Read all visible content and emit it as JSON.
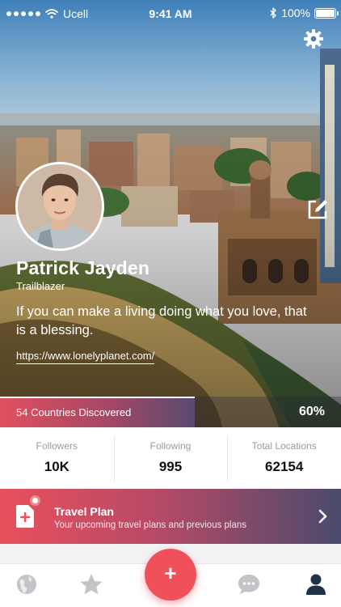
{
  "status_bar": {
    "carrier": "Ucell",
    "time": "9:41 AM",
    "battery": "100%"
  },
  "profile": {
    "name": "Patrick Jayden",
    "title": "Trailblazer",
    "quote": "If you can make a living doing what you love, that is a blessing.",
    "link": "https://www.lonelyplanet.com/"
  },
  "progress": {
    "label": "54 Countries Discovered",
    "percent_label": "60%",
    "fraction": 0.57
  },
  "stats": [
    {
      "label": "Followers",
      "value": "10K"
    },
    {
      "label": "Following",
      "value": "995"
    },
    {
      "label": "Total Locations",
      "value": "62154"
    }
  ],
  "travel_plan": {
    "title": "Travel Plan",
    "subtitle": "Your upcoming travel plans and previous plans"
  },
  "tabbar": {
    "items": [
      "globe-icon",
      "star-icon",
      "add-icon",
      "chat-icon",
      "profile-icon"
    ],
    "active": "profile-icon",
    "fab_symbol": "+"
  },
  "colors": {
    "accent": "#f0505a",
    "gradient_start": "#e8505c",
    "gradient_end": "#4b4a6c",
    "inactive_icon": "#c4c4c8",
    "active_icon": "#1f3147"
  }
}
